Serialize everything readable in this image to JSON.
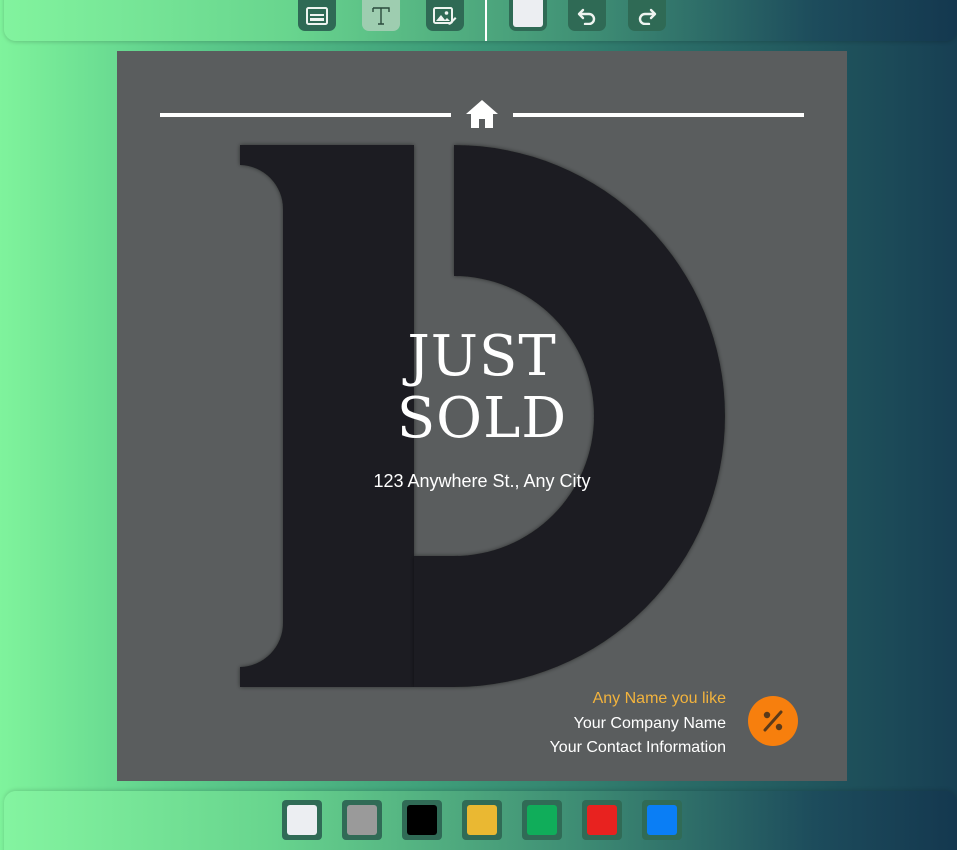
{
  "toolbar": {
    "tools": [
      {
        "name": "background-tool",
        "icon": "panel-icon",
        "active": false
      },
      {
        "name": "text-tool",
        "icon": "text-t-icon",
        "active": true
      },
      {
        "name": "image-tool",
        "icon": "image-edit-icon",
        "active": false
      }
    ],
    "current_color": "#eceef2",
    "undo_icon": "undo-icon",
    "redo_icon": "redo-icon"
  },
  "design": {
    "headline_line1": "JUST",
    "headline_line2": "SOLD",
    "address": "123 Anywhere St., Any City",
    "agent_name": "Any Name you like",
    "company": "Your Company Name",
    "contact": "Your Contact Information",
    "icons": {
      "top": "home-icon",
      "badge": "percent-icon"
    },
    "colors": {
      "background": "#5a5d5e",
      "letter": "#1c1f20",
      "text": "#ffffff",
      "accent_name": "#f2b33d",
      "badge": "#f77f0d"
    }
  },
  "palette": {
    "colors": [
      "#eceef2",
      "#9a9a9a",
      "#000000",
      "#eab832",
      "#10ad5a",
      "#e8221f",
      "#0a7ef5"
    ]
  }
}
